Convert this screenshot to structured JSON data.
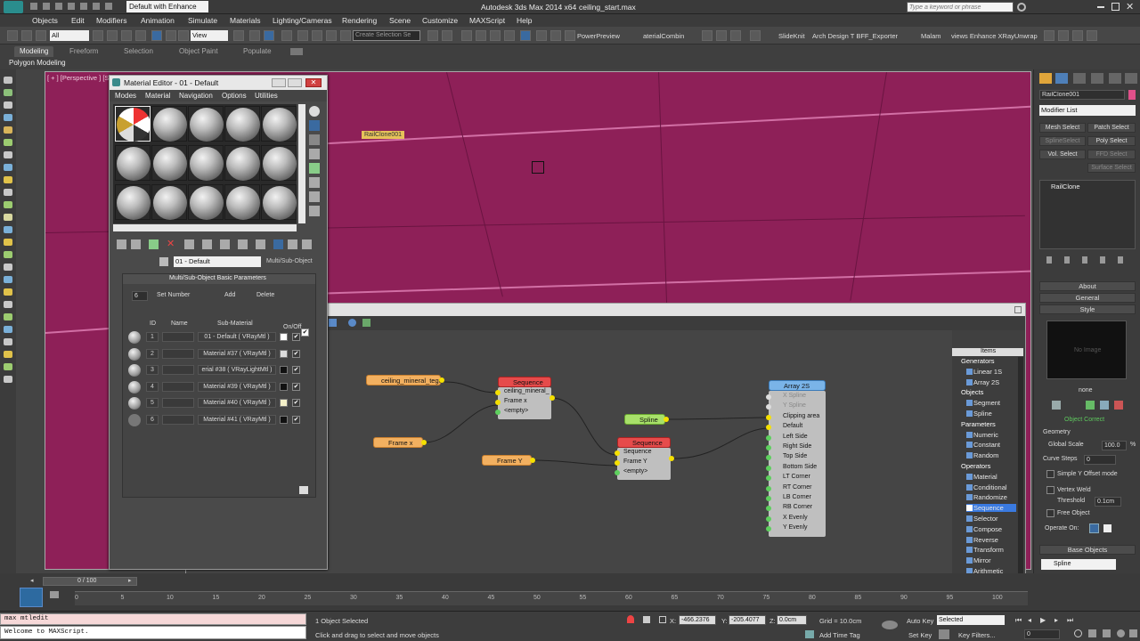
{
  "titlebar": {
    "workspace": "Default with Enhance",
    "app_title": "Autodesk 3ds Max 2014 x64",
    "file_name": "ceiling_start.max",
    "search_placeholder": "Type a keyword or phrase"
  },
  "menu": [
    "Objects",
    "Edit",
    "Modifiers",
    "Animation",
    "Simulate",
    "Materials",
    "Lighting/Cameras",
    "Rendering",
    "Scene",
    "Customize",
    "MAXScript",
    "Help"
  ],
  "toolbar": {
    "selection_filter": "All",
    "ref_coord": "View",
    "named_selection": "Create Selection Se",
    "power_preview": "PowerPreview",
    "material_combiner": "aterialCombin",
    "slideknit": "SlideKnit",
    "arch_design": "Arch Design T BFF_Exporter",
    "malam": "Malam",
    "vray_unwrap": "views Enhance XRayUnwrap"
  },
  "ribbon": {
    "tabs": [
      "Modeling",
      "Freeform",
      "Selection",
      "Object Paint",
      "Populate"
    ],
    "sub_label": "Polygon Modeling"
  },
  "viewport": {
    "label": "[ + ] [Perspective ] [S",
    "object_tag": "RailClone001"
  },
  "material_editor": {
    "title": "Material Editor - 01 - Default",
    "menu": [
      "Modes",
      "Material",
      "Navigation",
      "Options",
      "Utilities"
    ],
    "current_material": "01 - Default",
    "material_type": "Multi/Sub-Object",
    "rollout_title": "Multi/Sub-Object Basic Parameters",
    "set_number_value": "6",
    "set_number_label": "Set Number",
    "add_label": "Add",
    "delete_label": "Delete",
    "columns": {
      "id": "ID",
      "name": "Name",
      "sub": "Sub-Material",
      "onoff": "On/Off"
    },
    "rows": [
      {
        "id": "1",
        "sub": "01 - Default ( VRayMtl )",
        "swatch": "#ffffff"
      },
      {
        "id": "2",
        "sub": "Material #37 ( VRayMtl )",
        "swatch": "#dddddd"
      },
      {
        "id": "3",
        "sub": "erial #38 ( VRayLightMtl )",
        "swatch": "#111111"
      },
      {
        "id": "4",
        "sub": "Material #39 ( VRayMtl )",
        "swatch": "#111111"
      },
      {
        "id": "5",
        "sub": "Material #40 ( VRayMtl )",
        "swatch": "#f4f0c8"
      },
      {
        "id": "6",
        "sub": "Material #41 ( VRayMtl )",
        "swatch": "#111111"
      }
    ]
  },
  "railclone": {
    "nodes": {
      "ceiling": "ceiling_mineral_tegu",
      "seq1": "Sequence",
      "seq1_inputs": [
        "ceiling_mineral_",
        "Frame x",
        "<empty>"
      ],
      "frame_x": "Frame x",
      "frame_y": "Frame Y",
      "seq2": "Sequence",
      "seq2_inputs": [
        "Sequence",
        "Frame Y",
        "<empty>"
      ],
      "spline": "Spline",
      "array": "Array 2S",
      "array_inputs": [
        "X Spline",
        "Y Spline",
        "Clipping area",
        "Default",
        "Left Side",
        "Right Side",
        "Top Side",
        "Bottom Side",
        "LT Corner",
        "RT Corner",
        "LB Corner",
        "RB Corner",
        "X Evenly",
        "Y Evenly"
      ]
    },
    "items_title": "Items",
    "items": [
      {
        "type": "cat",
        "label": "Generators"
      },
      {
        "type": "it",
        "label": "Linear 1S"
      },
      {
        "type": "it",
        "label": "Array 2S"
      },
      {
        "type": "cat",
        "label": "Objects"
      },
      {
        "type": "it",
        "label": "Segment"
      },
      {
        "type": "it",
        "label": "Spline"
      },
      {
        "type": "cat",
        "label": "Parameters"
      },
      {
        "type": "it",
        "label": "Numeric"
      },
      {
        "type": "it",
        "label": "Constant"
      },
      {
        "type": "it",
        "label": "Random"
      },
      {
        "type": "cat",
        "label": "Operators"
      },
      {
        "type": "it",
        "label": "Material"
      },
      {
        "type": "it",
        "label": "Conditional"
      },
      {
        "type": "it",
        "label": "Randomize"
      },
      {
        "type": "sel",
        "label": "Sequence"
      },
      {
        "type": "it",
        "label": "Selector"
      },
      {
        "type": "it",
        "label": "Compose"
      },
      {
        "type": "it",
        "label": "Reverse"
      },
      {
        "type": "it",
        "label": "Transform"
      },
      {
        "type": "it",
        "label": "Mirror"
      },
      {
        "type": "it",
        "label": "Arithmetic"
      },
      {
        "type": "cat",
        "label": "Others"
      },
      {
        "type": "it",
        "label": "Note"
      }
    ]
  },
  "command_panel": {
    "object_name": "RailClone001",
    "modifier_list": "Modifier List",
    "buttons": [
      {
        "label": "Mesh Select",
        "dim": false
      },
      {
        "label": "Patch Select",
        "dim": false
      },
      {
        "label": "SplineSelect",
        "dim": true
      },
      {
        "label": "Poly Select",
        "dim": false
      },
      {
        "label": "Vol. Select",
        "dim": false
      },
      {
        "label": "FFD Select",
        "dim": true
      },
      {
        "label": "Surface Select",
        "dim": true
      }
    ],
    "stack_item": "RailClone",
    "rollouts": [
      "About",
      "General",
      "Style"
    ],
    "no_image": "No Image",
    "style_name": "none",
    "object_correct": "Object Correct",
    "geometry_label": "Geometry",
    "global_scale_label": "Global Scale",
    "global_scale_value": "100.0",
    "global_scale_unit": "%",
    "curve_steps_label": "Curve Steps",
    "curve_steps_value": "0",
    "simple_offset": "Simple Y Offset mode",
    "vertex_weld": "Vertex Weld",
    "threshold_label": "Threshold",
    "threshold_value": "0.1cm",
    "free_object": "Free Object",
    "operate_on": "Operate On:",
    "base_objects_title": "Base Objects",
    "base_object_item": "Spline"
  },
  "timeline": {
    "frame_counter": "0 / 100",
    "ticks": [
      "0",
      "5",
      "10",
      "15",
      "20",
      "25",
      "30",
      "35",
      "40",
      "45",
      "50",
      "55",
      "60",
      "65",
      "70",
      "75",
      "80",
      "85",
      "90",
      "95",
      "100"
    ]
  },
  "status": {
    "maxscript_line1": "max mtledit",
    "maxscript_line2": "Welcome to MAXScript.",
    "selected_count": "1 Object Selected",
    "prompt": "Click and drag to select and move objects",
    "x_label": "X:",
    "x_value": "-466.2376",
    "y_label": "Y:",
    "y_value": "-205.4077",
    "z_label": "Z:",
    "z_value": "0.0cm",
    "grid": "Grid = 10.0cm",
    "add_time_tag": "Add Time Tag",
    "auto_key": "Auto Key",
    "set_key": "Set Key",
    "selected_dropdown": "Selected",
    "key_filters": "Key Filters...",
    "frame_field": "0"
  }
}
